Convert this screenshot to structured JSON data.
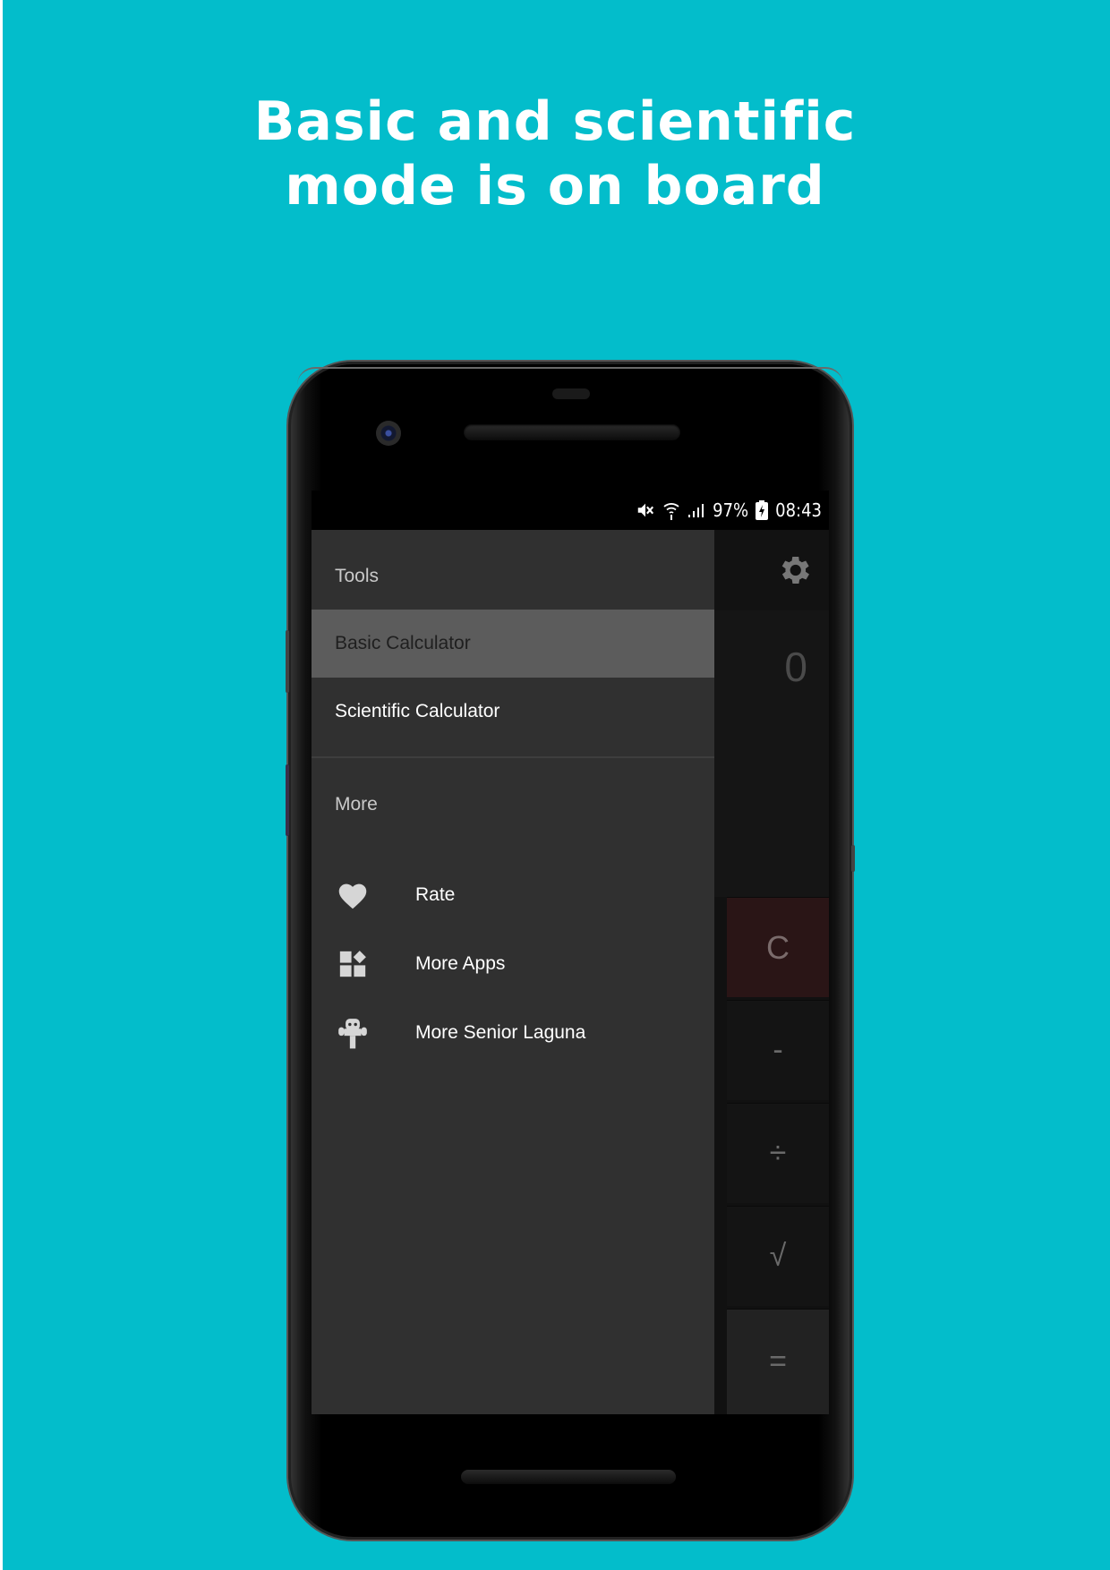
{
  "headline": {
    "line1": "Basic and scientific",
    "line2": "mode is on board"
  },
  "statusbar": {
    "battery_percent": "97%",
    "time": "08:43",
    "icons": [
      "mute-icon",
      "wifi-icon",
      "signal-icon",
      "battery-charging-icon"
    ]
  },
  "drawer": {
    "tools_label": "Tools",
    "items": [
      {
        "label": "Basic Calculator",
        "selected": true
      },
      {
        "label": "Scientific Calculator",
        "selected": false
      }
    ],
    "more_label": "More",
    "more_items": [
      {
        "label": "Rate",
        "icon": "heart-icon"
      },
      {
        "label": "More Apps",
        "icon": "widgets-icon"
      },
      {
        "label": "More Senior Laguna",
        "icon": "robot-icon"
      }
    ]
  },
  "calculator": {
    "display_value": "0",
    "keys": {
      "clear": "C",
      "minus": "-",
      "divide": "÷",
      "sqrt": "√",
      "equals": "="
    }
  },
  "colors": {
    "background": "#03bdcb",
    "drawer": "#303030",
    "selected_item": "#5c5c5c"
  }
}
